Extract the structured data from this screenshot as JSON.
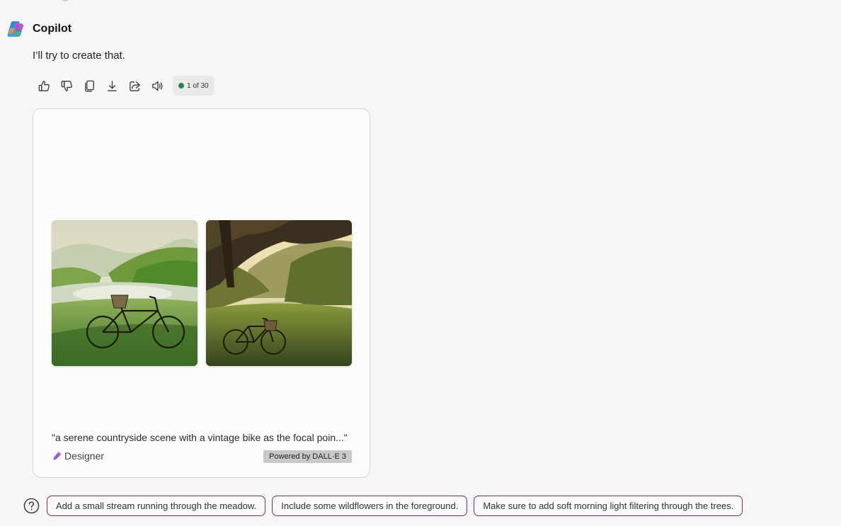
{
  "header": {
    "name": "Copilot",
    "logo_icon": "copilot-logo-icon"
  },
  "message": {
    "text": "I’ll try to create that."
  },
  "toolbar": {
    "buttons": [
      {
        "icon": "thumbs-up-icon"
      },
      {
        "icon": "thumbs-down-icon"
      },
      {
        "icon": "copy-icon"
      },
      {
        "icon": "download-icon"
      },
      {
        "icon": "share-icon"
      },
      {
        "icon": "speaker-icon"
      }
    ],
    "counter": "1 of 30",
    "counter_dot_color": "#1f8a4c"
  },
  "card": {
    "images": [
      {
        "name": "generated-image-1"
      },
      {
        "name": "generated-image-2"
      }
    ],
    "prompt": "\"a serene countryside scene with a vintage bike as the focal poin...\"",
    "designer_label": "Designer",
    "powered_label": "Powered by DALL·E 3"
  },
  "suggestions": {
    "help_icon": "question-icon",
    "chip_border_color": "#7a2f64",
    "items": [
      "Add a small stream running through the meadow.",
      "Include some wildflowers in the foreground.",
      "Make sure to add soft morning light filtering through the trees."
    ]
  }
}
